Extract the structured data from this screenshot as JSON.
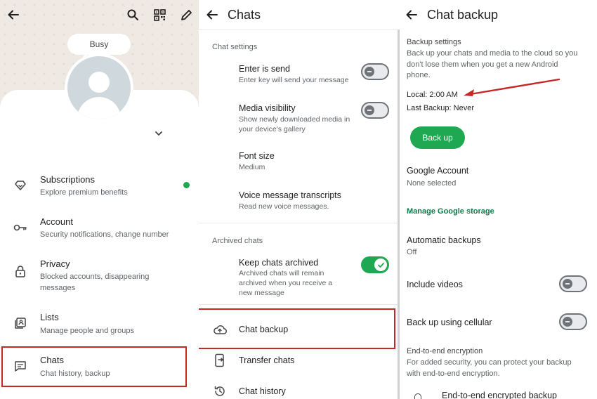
{
  "colors": {
    "accent": "#1da851",
    "highlight": "#c62828",
    "text": "#1f1f1f",
    "muted": "#5f6368"
  },
  "profile_panel": {
    "status_bubble": "Busy",
    "icons": [
      "back-arrow-icon",
      "search-icon",
      "qr-code-icon",
      "edit-pencil-icon",
      "chevron-down-icon"
    ],
    "items": [
      {
        "title": "Subscriptions",
        "subtitle": "Explore premium benefits",
        "icon": "diamond-icon",
        "has_dot": true
      },
      {
        "title": "Account",
        "subtitle": "Security notifications, change number",
        "icon": "key-icon"
      },
      {
        "title": "Privacy",
        "subtitle": "Blocked accounts, disappearing messages",
        "icon": "lock-icon"
      },
      {
        "title": "Lists",
        "subtitle": "Manage people and groups",
        "icon": "lists-icon"
      },
      {
        "title": "Chats",
        "subtitle": "Chat history, backup",
        "icon": "chat-icon",
        "highlighted": true
      }
    ]
  },
  "chats_panel": {
    "title": "Chats",
    "section_settings": "Chat settings",
    "settings": [
      {
        "title": "Enter is send",
        "subtitle": "Enter key will send your message",
        "toggle": false
      },
      {
        "title": "Media visibility",
        "subtitle": "Show newly downloaded media in your device's gallery",
        "toggle": false
      },
      {
        "title": "Font size",
        "subtitle": "Medium"
      },
      {
        "title": "Voice message transcripts",
        "subtitle": "Read new voice messages."
      }
    ],
    "section_archived": "Archived chats",
    "archived": {
      "title": "Keep chats archived",
      "subtitle": "Archived chats will remain archived when you receive a new message",
      "toggle": true
    },
    "actions": [
      {
        "title": "Chat backup",
        "icon": "cloud-upload-icon",
        "highlighted": true
      },
      {
        "title": "Transfer chats",
        "icon": "phone-transfer-icon"
      },
      {
        "title": "Chat history",
        "icon": "history-icon"
      }
    ]
  },
  "backup_panel": {
    "title": "Chat backup",
    "section_settings": "Backup settings",
    "description": "Back up your chats and media to the cloud so you don't lose them when you get a new Android phone.",
    "local": "Local: 2:00 AM",
    "last_backup": "Last Backup: Never",
    "backup_button": "Back up",
    "google_account_title": "Google Account",
    "google_account_value": "None selected",
    "manage_storage": "Manage Google storage",
    "auto_backups_title": "Automatic backups",
    "auto_backups_value": "Off",
    "include_videos": "Include videos",
    "include_videos_toggle": false,
    "cellular": "Back up using cellular",
    "cellular_toggle": false,
    "e2e_heading": "End-to-end encryption",
    "e2e_desc": "For added security, you can protect your backup with end-to-end encryption.",
    "e2e_item": "End-to-end encrypted backup"
  }
}
